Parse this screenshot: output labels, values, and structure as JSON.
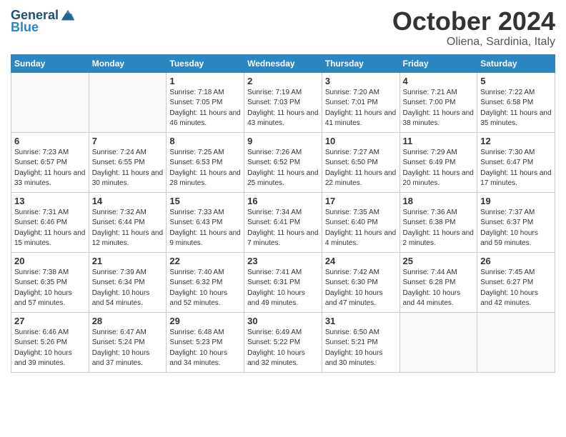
{
  "logo": {
    "text_general": "General",
    "text_blue": "Blue"
  },
  "header": {
    "month": "October 2024",
    "location": "Oliena, Sardinia, Italy"
  },
  "weekdays": [
    "Sunday",
    "Monday",
    "Tuesday",
    "Wednesday",
    "Thursday",
    "Friday",
    "Saturday"
  ],
  "weeks": [
    [
      {
        "day": "",
        "info": ""
      },
      {
        "day": "",
        "info": ""
      },
      {
        "day": "1",
        "info": "Sunrise: 7:18 AM\nSunset: 7:05 PM\nDaylight: 11 hours and 46 minutes."
      },
      {
        "day": "2",
        "info": "Sunrise: 7:19 AM\nSunset: 7:03 PM\nDaylight: 11 hours and 43 minutes."
      },
      {
        "day": "3",
        "info": "Sunrise: 7:20 AM\nSunset: 7:01 PM\nDaylight: 11 hours and 41 minutes."
      },
      {
        "day": "4",
        "info": "Sunrise: 7:21 AM\nSunset: 7:00 PM\nDaylight: 11 hours and 38 minutes."
      },
      {
        "day": "5",
        "info": "Sunrise: 7:22 AM\nSunset: 6:58 PM\nDaylight: 11 hours and 35 minutes."
      }
    ],
    [
      {
        "day": "6",
        "info": "Sunrise: 7:23 AM\nSunset: 6:57 PM\nDaylight: 11 hours and 33 minutes."
      },
      {
        "day": "7",
        "info": "Sunrise: 7:24 AM\nSunset: 6:55 PM\nDaylight: 11 hours and 30 minutes."
      },
      {
        "day": "8",
        "info": "Sunrise: 7:25 AM\nSunset: 6:53 PM\nDaylight: 11 hours and 28 minutes."
      },
      {
        "day": "9",
        "info": "Sunrise: 7:26 AM\nSunset: 6:52 PM\nDaylight: 11 hours and 25 minutes."
      },
      {
        "day": "10",
        "info": "Sunrise: 7:27 AM\nSunset: 6:50 PM\nDaylight: 11 hours and 22 minutes."
      },
      {
        "day": "11",
        "info": "Sunrise: 7:29 AM\nSunset: 6:49 PM\nDaylight: 11 hours and 20 minutes."
      },
      {
        "day": "12",
        "info": "Sunrise: 7:30 AM\nSunset: 6:47 PM\nDaylight: 11 hours and 17 minutes."
      }
    ],
    [
      {
        "day": "13",
        "info": "Sunrise: 7:31 AM\nSunset: 6:46 PM\nDaylight: 11 hours and 15 minutes."
      },
      {
        "day": "14",
        "info": "Sunrise: 7:32 AM\nSunset: 6:44 PM\nDaylight: 11 hours and 12 minutes."
      },
      {
        "day": "15",
        "info": "Sunrise: 7:33 AM\nSunset: 6:43 PM\nDaylight: 11 hours and 9 minutes."
      },
      {
        "day": "16",
        "info": "Sunrise: 7:34 AM\nSunset: 6:41 PM\nDaylight: 11 hours and 7 minutes."
      },
      {
        "day": "17",
        "info": "Sunrise: 7:35 AM\nSunset: 6:40 PM\nDaylight: 11 hours and 4 minutes."
      },
      {
        "day": "18",
        "info": "Sunrise: 7:36 AM\nSunset: 6:38 PM\nDaylight: 11 hours and 2 minutes."
      },
      {
        "day": "19",
        "info": "Sunrise: 7:37 AM\nSunset: 6:37 PM\nDaylight: 10 hours and 59 minutes."
      }
    ],
    [
      {
        "day": "20",
        "info": "Sunrise: 7:38 AM\nSunset: 6:35 PM\nDaylight: 10 hours and 57 minutes."
      },
      {
        "day": "21",
        "info": "Sunrise: 7:39 AM\nSunset: 6:34 PM\nDaylight: 10 hours and 54 minutes."
      },
      {
        "day": "22",
        "info": "Sunrise: 7:40 AM\nSunset: 6:32 PM\nDaylight: 10 hours and 52 minutes."
      },
      {
        "day": "23",
        "info": "Sunrise: 7:41 AM\nSunset: 6:31 PM\nDaylight: 10 hours and 49 minutes."
      },
      {
        "day": "24",
        "info": "Sunrise: 7:42 AM\nSunset: 6:30 PM\nDaylight: 10 hours and 47 minutes."
      },
      {
        "day": "25",
        "info": "Sunrise: 7:44 AM\nSunset: 6:28 PM\nDaylight: 10 hours and 44 minutes."
      },
      {
        "day": "26",
        "info": "Sunrise: 7:45 AM\nSunset: 6:27 PM\nDaylight: 10 hours and 42 minutes."
      }
    ],
    [
      {
        "day": "27",
        "info": "Sunrise: 6:46 AM\nSunset: 5:26 PM\nDaylight: 10 hours and 39 minutes."
      },
      {
        "day": "28",
        "info": "Sunrise: 6:47 AM\nSunset: 5:24 PM\nDaylight: 10 hours and 37 minutes."
      },
      {
        "day": "29",
        "info": "Sunrise: 6:48 AM\nSunset: 5:23 PM\nDaylight: 10 hours and 34 minutes."
      },
      {
        "day": "30",
        "info": "Sunrise: 6:49 AM\nSunset: 5:22 PM\nDaylight: 10 hours and 32 minutes."
      },
      {
        "day": "31",
        "info": "Sunrise: 6:50 AM\nSunset: 5:21 PM\nDaylight: 10 hours and 30 minutes."
      },
      {
        "day": "",
        "info": ""
      },
      {
        "day": "",
        "info": ""
      }
    ]
  ]
}
